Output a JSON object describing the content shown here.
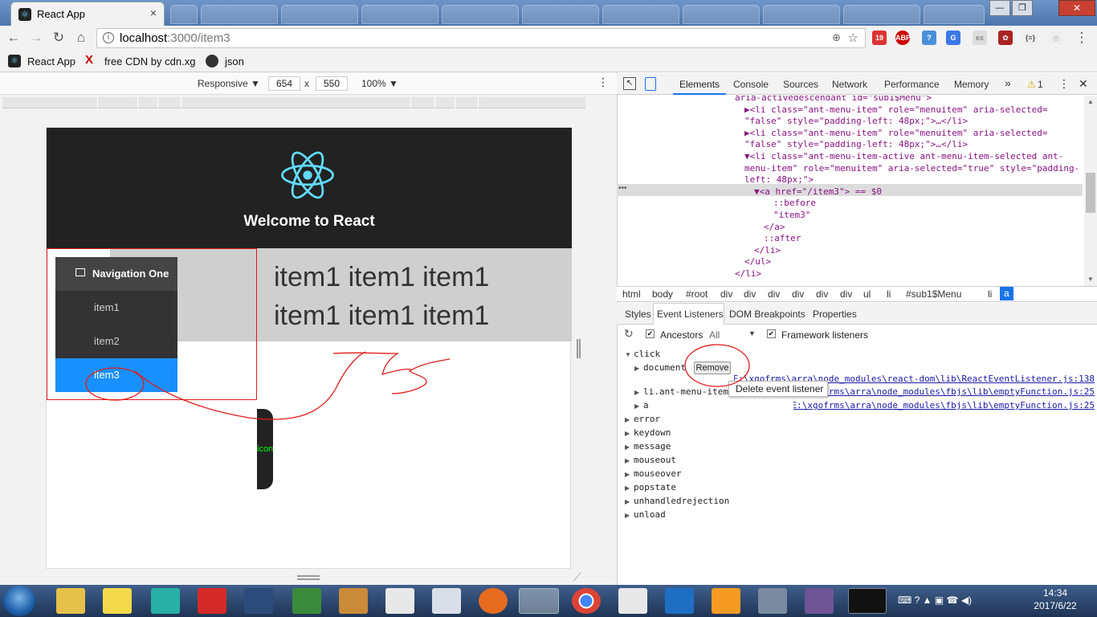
{
  "browser": {
    "tab_title": "React App",
    "tab_close": "×",
    "url_host": "localhost",
    "url_path": ":3000/item3",
    "bookmarks": [
      "React App",
      "free CDN by cdn.xg",
      "json"
    ],
    "window_buttons": [
      "—",
      "❐",
      "✕"
    ]
  },
  "device_toolbar": {
    "mode": "Responsive ▼",
    "width": "654",
    "times": "x",
    "height": "550",
    "zoom": "100% ▼",
    "menu": "⋮"
  },
  "app": {
    "welcome": "Welcome to React",
    "menu_title": "Navigation One",
    "menu_items": [
      "item1",
      "item2",
      "item3"
    ],
    "selected_item": "item3",
    "content_line1": "item1 item1 item1",
    "content_line2": "item1 item1 item1",
    "icon_pill": "icon"
  },
  "devtools": {
    "tabs": [
      "Elements",
      "Console",
      "Sources",
      "Network",
      "Performance",
      "Memory"
    ],
    "more": "»",
    "warning_count": "1",
    "code_lines": [
      {
        "indent": 915,
        "text": "aria-activedescendant id=\"sub1$Menu\">"
      },
      {
        "indent": 927,
        "text": "▶<li class=\"ant-menu-item\" role=\"menuitem\" aria-selected="
      },
      {
        "indent": 927,
        "text": "\"false\" style=\"padding-left: 48px;\">…</li>"
      },
      {
        "indent": 927,
        "text": "▶<li class=\"ant-menu-item\" role=\"menuitem\" aria-selected="
      },
      {
        "indent": 927,
        "text": "\"false\" style=\"padding-left: 48px;\">…</li>"
      },
      {
        "indent": 927,
        "text": "▼<li class=\"ant-menu-item-active ant-menu-item-selected ant-"
      },
      {
        "indent": 927,
        "text": "menu-item\" role=\"menuitem\" aria-selected=\"true\" style=\"padding-"
      },
      {
        "indent": 927,
        "text": "left: 48px;\">"
      },
      {
        "indent": 939,
        "text": "▼<a href=\"/item3\"> == $0"
      },
      {
        "indent": 963,
        "text": "::before"
      },
      {
        "indent": 963,
        "text": "\"item3\""
      },
      {
        "indent": 951,
        "text": "</a>"
      },
      {
        "indent": 951,
        "text": "::after"
      },
      {
        "indent": 939,
        "text": "</li>"
      },
      {
        "indent": 927,
        "text": "</ul>"
      },
      {
        "indent": 915,
        "text": "</li>"
      }
    ],
    "breadcrumbs": [
      "html",
      "body",
      "#root",
      "div",
      "div",
      "div",
      "div",
      "div",
      "div",
      "ul",
      "li",
      "#sub1$Menu",
      "li"
    ],
    "breadcrumb_selected": "a",
    "subtabs": [
      "Styles",
      "Event Listeners",
      "DOM Breakpoints",
      "Properties"
    ],
    "ancestors_label": "Ancestors",
    "ancestors_filter": "All",
    "framework_label": "Framework listeners",
    "events": {
      "click": "click",
      "listeners": [
        {
          "target": "document",
          "link": "E:\\xgofrms\\arra\\node_modules\\react-dom\\lib\\ReactEventListener.js:138"
        },
        {
          "target": "li.ant-menu-item",
          "link": "E:\\xgofrms\\arra\\node_modules\\fbjs\\lib\\emptyFunction.js:25"
        },
        {
          "target": "a",
          "link": "E:\\xgofrms\\arra\\node_modules\\fbjs\\lib\\emptyFunction.js:25"
        }
      ],
      "others": [
        "error",
        "keydown",
        "message",
        "mouseout",
        "mouseover",
        "popstate",
        "unhandledrejection",
        "unload"
      ]
    },
    "remove_button": "Remove",
    "tooltip": "Delete event listener"
  },
  "taskbar": {
    "time": "14:34",
    "date": "2017/6/22"
  },
  "colors": {
    "menu_selected": "#1890ff",
    "header_bg": "#222222",
    "annotation_red": "#e21b1b",
    "devtools_accent": "#1a73e8"
  }
}
